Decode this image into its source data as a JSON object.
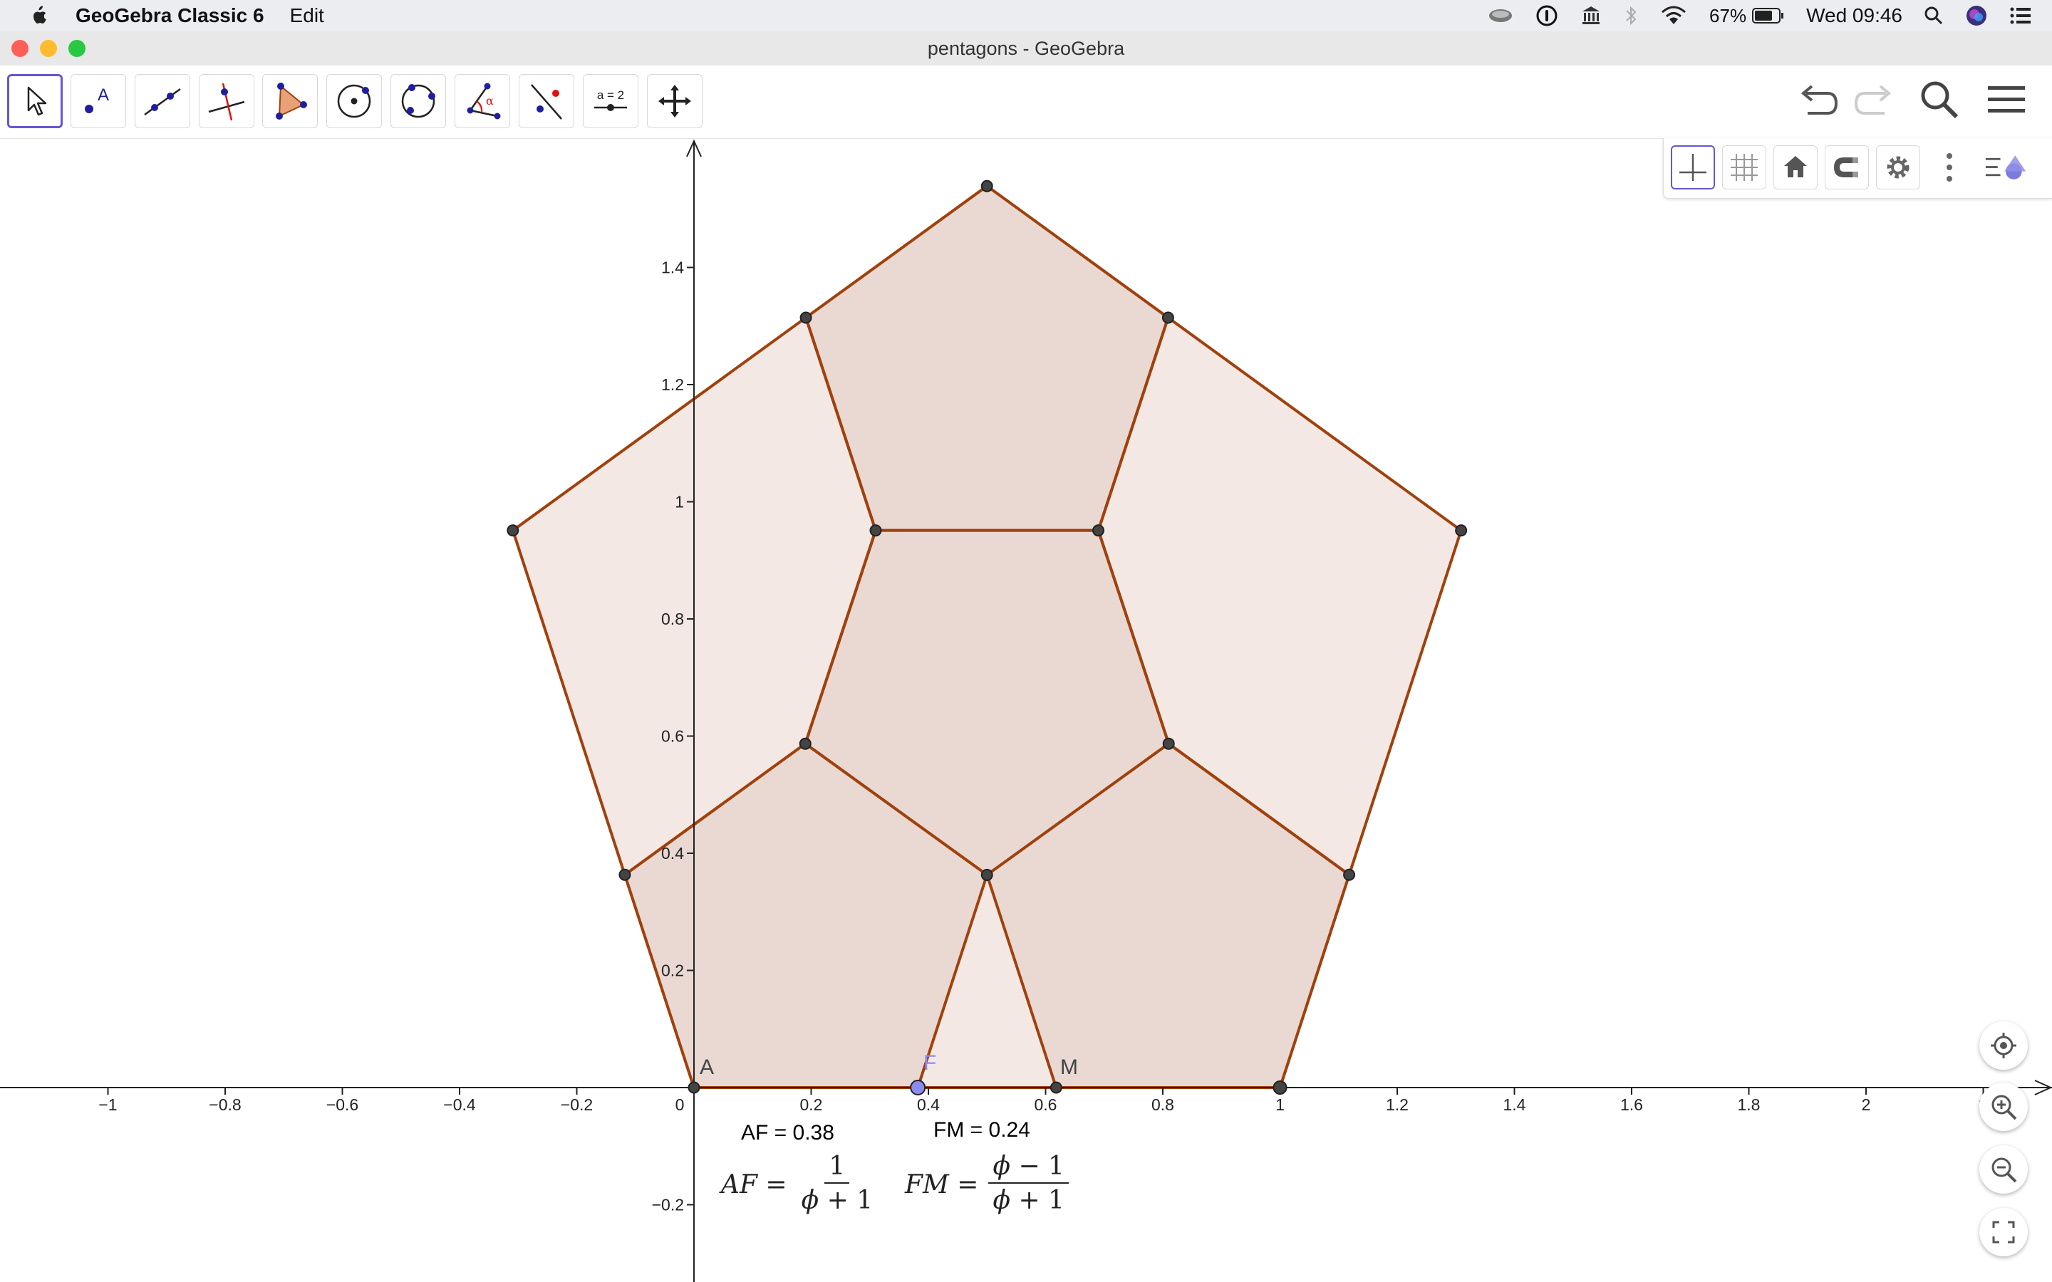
{
  "menubar": {
    "app_name": "GeoGebra Classic 6",
    "menu_edit": "Edit",
    "battery_percent": "67%",
    "clock": "Wed 09:46"
  },
  "window": {
    "title": "pentagons - GeoGebra"
  },
  "toolbar": {
    "tools": [
      "move-tool",
      "point-tool",
      "line-tool",
      "perpendicular-line-tool",
      "polygon-tool",
      "circle-center-point-tool",
      "circle-three-points-tool",
      "angle-tool",
      "reflect-about-line-tool",
      "slider-tool",
      "move-graphics-view-tool"
    ],
    "slider_icon_text": "a = 2",
    "angle_icon_text": "α"
  },
  "graphics": {
    "x_ticks": [
      "−1",
      "−0.8",
      "−0.6",
      "−0.4",
      "−0.2",
      "0",
      "0.2",
      "0.4",
      "0.6",
      "0.8",
      "1",
      "1.2",
      "1.4",
      "1.6",
      "1.8",
      "2",
      "2"
    ],
    "y_ticks": [
      "1.4",
      "1.2",
      "1",
      "0.8",
      "0.6",
      "0.4",
      "0.2",
      "−0.2"
    ],
    "point_labels": {
      "A": "A",
      "F": "F",
      "M": "M"
    },
    "text_af": "AF = 0.38",
    "text_fm": "FM = 0.24",
    "formula_af": {
      "lhs": "AF =",
      "num": "1",
      "den_phi": "ϕ",
      "den_rest": " + 1"
    },
    "formula_fm": {
      "lhs": "FM =",
      "num_phi": "ϕ",
      "num_rest": " − 1",
      "den_phi": "ϕ",
      "den_rest": " + 1"
    },
    "colors": {
      "polygon_stroke": "#a0410d",
      "polygon_fill_light": "#f3e8e4",
      "polygon_fill_dark": "#e9d9d2",
      "point_fill": "#444444",
      "point_F": "#8a8af2"
    }
  }
}
